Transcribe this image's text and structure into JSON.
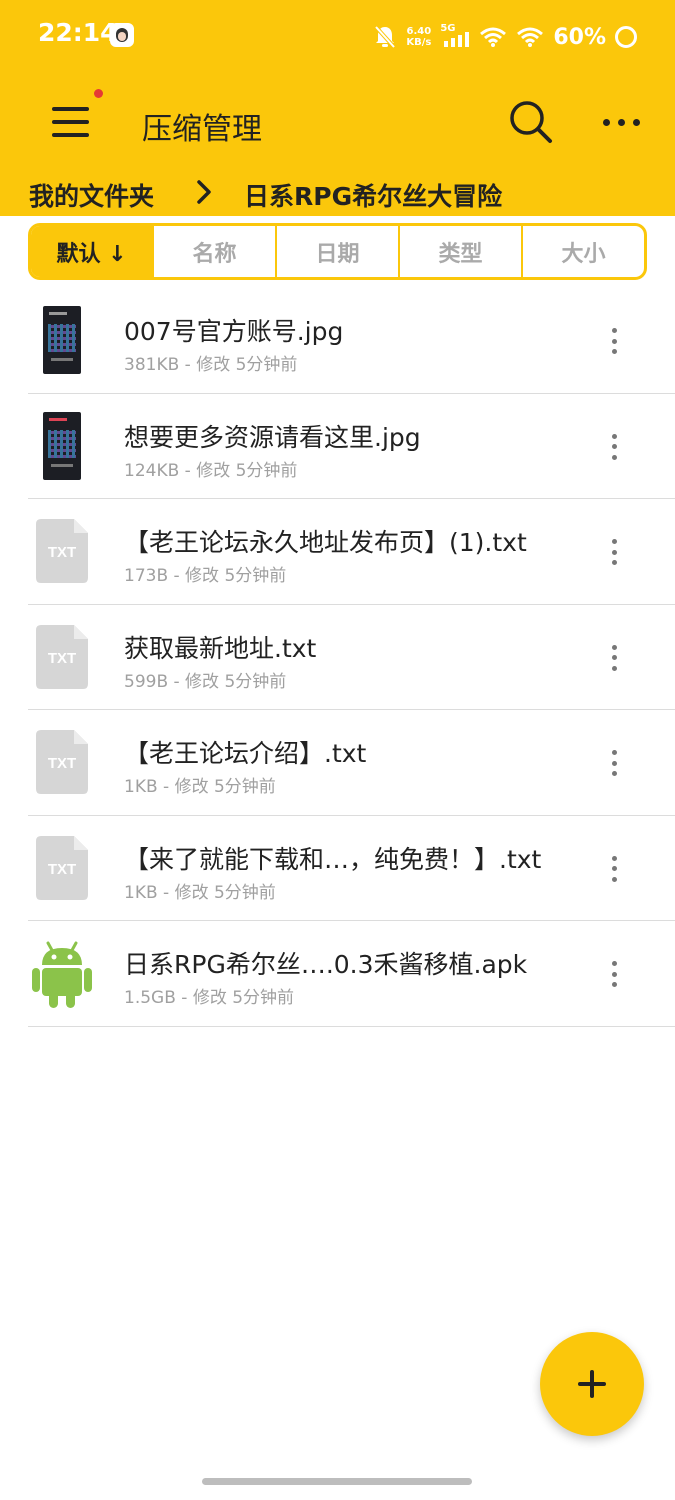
{
  "status_bar": {
    "time": "22:14",
    "net_speed_value": "6.40",
    "net_speed_unit": "KB/s",
    "network_type": "5G",
    "battery": "60%",
    "icons": [
      "avatar-icon",
      "mute-bell-icon",
      "signal-icon",
      "wifi-icon",
      "wifi-icon",
      "battery-ring-icon"
    ]
  },
  "app_bar": {
    "title": "压缩管理",
    "icons": [
      "menu-icon",
      "search-icon",
      "more-icon"
    ]
  },
  "breadcrumb": {
    "items": [
      "我的文件夹",
      "日系RPG希尔丝大冒险"
    ]
  },
  "sort_tabs": [
    {
      "label": "默认 ↓",
      "active": true
    },
    {
      "label": "名称",
      "active": false
    },
    {
      "label": "日期",
      "active": false
    },
    {
      "label": "类型",
      "active": false
    },
    {
      "label": "大小",
      "active": false
    }
  ],
  "files": [
    {
      "name": "007号官方账号.jpg",
      "meta": "381KB - 修改 5分钟前",
      "type": "image"
    },
    {
      "name": "想要更多资源请看这里.jpg",
      "meta": "124KB - 修改 5分钟前",
      "type": "image"
    },
    {
      "name": "【老王论坛永久地址发布页】(1).txt",
      "meta": "173B - 修改 5分钟前",
      "type": "txt",
      "icon_label": "TXT"
    },
    {
      "name": "获取最新地址.txt",
      "meta": "599B - 修改 5分钟前",
      "type": "txt",
      "icon_label": "TXT"
    },
    {
      "name": "【老王论坛介绍】.txt",
      "meta": "1KB - 修改 5分钟前",
      "type": "txt",
      "icon_label": "TXT"
    },
    {
      "name": "【来了就能下载和…，纯免费！】.txt",
      "meta": "1KB - 修改 5分钟前",
      "type": "txt",
      "icon_label": "TXT"
    },
    {
      "name": "日系RPG希尔丝….0.3禾酱移植.apk",
      "meta": "1.5GB - 修改 5分钟前",
      "type": "apk"
    }
  ],
  "fab": {
    "icon": "plus-icon"
  },
  "colors": {
    "accent": "#FBC70B",
    "apk_green": "#8BC34A",
    "txt_gray": "#D6D6D6"
  }
}
